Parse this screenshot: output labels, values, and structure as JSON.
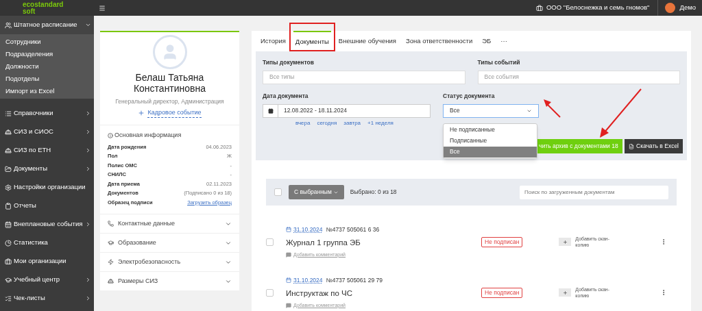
{
  "header": {
    "logo_line1": "ecostandard",
    "logo_line2": "soft",
    "org": "ООО \"Белоснежка и семь гномов\"",
    "user": "Демо"
  },
  "sidebar": {
    "items": [
      {
        "label": "Штатное расписание",
        "expanded": true,
        "children": [
          {
            "label": "Сотрудники"
          },
          {
            "label": "Подразделения"
          },
          {
            "label": "Должности"
          },
          {
            "label": "Подотделы"
          },
          {
            "label": "Импорт из Excel"
          }
        ]
      },
      {
        "label": "Справочники",
        "expanded": false
      },
      {
        "label": "СИЗ и СИОС",
        "expanded": false
      },
      {
        "label": "СИЗ по ЕТН",
        "expanded": false
      },
      {
        "label": "Документы",
        "expanded": false
      },
      {
        "label": "Настройки организации"
      },
      {
        "label": "Отчеты"
      },
      {
        "label": "Внеплановые события",
        "expanded": false
      },
      {
        "label": "Статистика"
      },
      {
        "label": "Мои организации"
      },
      {
        "label": "Учебный центр",
        "expanded": false
      },
      {
        "label": "Чек-листы",
        "expanded": false
      }
    ]
  },
  "profile": {
    "name": "Белаш Татьяна Константиновна",
    "position": "Генеральный директор, Администрация",
    "action": "Кадровое событие",
    "info_title": "Основная информация",
    "info_rows": [
      {
        "label": "Дата рождения",
        "value": "04.06.2023",
        "kind": "text"
      },
      {
        "label": "Пол",
        "value": "Ж",
        "kind": "text"
      },
      {
        "label": "Полис ОМС",
        "value": "-",
        "kind": "text"
      },
      {
        "label": "СНИЛС",
        "value": "-",
        "kind": "text"
      },
      {
        "label": "Дата приема",
        "value": "02.11.2023",
        "kind": "text"
      },
      {
        "label": "Документов",
        "value": "(Подписано 0 из 18)",
        "kind": "text"
      },
      {
        "label": "Образец подписи",
        "value": "Загрузить образец",
        "kind": "link"
      }
    ],
    "sections": [
      {
        "label": "Контактные данные"
      },
      {
        "label": "Образование"
      },
      {
        "label": "Электробезопасность"
      },
      {
        "label": "Размеры СИЗ"
      }
    ]
  },
  "tabs": [
    {
      "label": "История",
      "selected": false,
      "highlighted": false
    },
    {
      "label": "Документы",
      "selected": true,
      "highlighted": true
    },
    {
      "label": "Внешние обучения",
      "selected": false,
      "highlighted": false
    },
    {
      "label": "Зона ответственности",
      "selected": false,
      "highlighted": false
    },
    {
      "label": "ЭБ",
      "selected": false,
      "highlighted": false
    },
    {
      "label": "···",
      "selected": false,
      "highlighted": false
    }
  ],
  "filters": {
    "doc_types": {
      "label": "Типы документов",
      "placeholder": "Все типы"
    },
    "event_types": {
      "label": "Типы событий",
      "placeholder": "Все события"
    },
    "date": {
      "label": "Дата документа",
      "value": "12.08.2022 - 18.11.2024",
      "shortcuts": [
        "вчера",
        "сегодня",
        "завтра",
        "+1 неделя"
      ]
    },
    "status": {
      "label": "Статус документа",
      "value": "Все",
      "expanded": true,
      "options": [
        {
          "label": "Не подписанные",
          "selected": false
        },
        {
          "label": "Подписанные",
          "selected": false
        },
        {
          "label": "Все",
          "selected": true
        }
      ]
    },
    "archive_button": "чить архив с документами 18",
    "excel_button": "Скачать в Excel"
  },
  "list": {
    "all_checked": false,
    "bulk_button": "С выбранным",
    "counter": "Выбрано: 0 из 18",
    "search_placeholder": "Поиск по загруженным документам",
    "documents": [
      {
        "date": "31.10.2024",
        "number": "№4737 505061 6 36",
        "title": "Журнал 1 группа ЭБ",
        "status": "Не подписан",
        "scan": "Добавить скан-копию",
        "comment": "Добавить комментарий",
        "checked": false
      },
      {
        "date": "31.10.2024",
        "number": "№4737 505061 29 79",
        "title": "Инструктаж по ЧС",
        "status": "Не подписан",
        "scan": "Добавить скан-копию",
        "comment": "Добавить комментарий",
        "checked": false
      }
    ]
  }
}
